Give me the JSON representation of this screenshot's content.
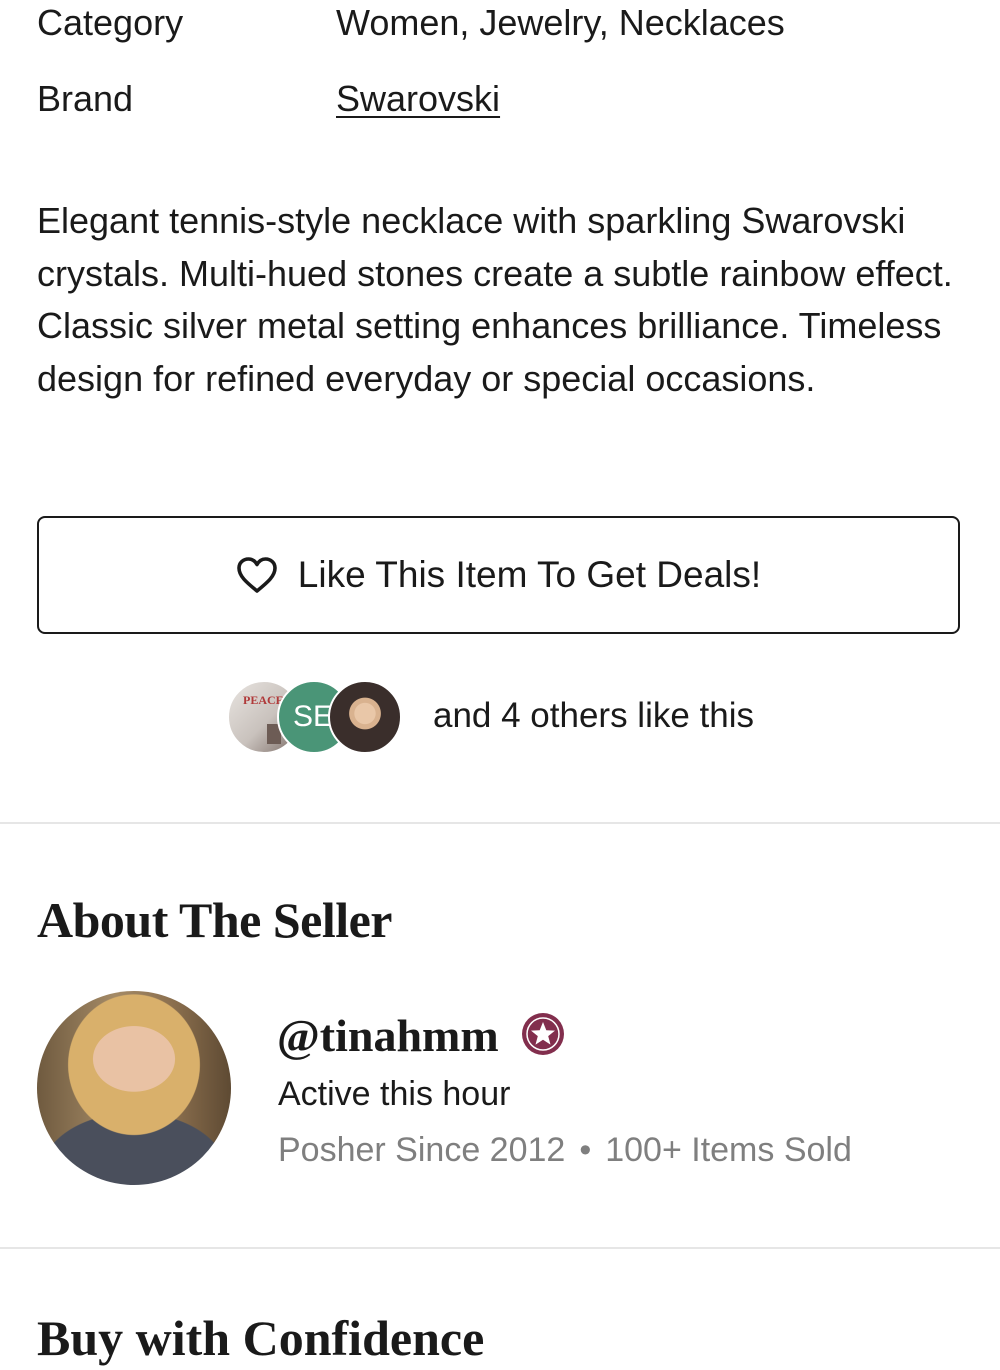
{
  "details": {
    "category_label": "Category",
    "category_value": "Women, Jewelry, Necklaces",
    "brand_label": "Brand",
    "brand_value": "Swarovski"
  },
  "description": "Elegant tennis-style necklace with sparkling Swarovski crystals. Multi-hued stones create a subtle rainbow effect. Classic silver metal setting enhances brilliance. Timeless design for refined everyday or special occasions.",
  "like_button": {
    "label": "Like This Item To Get Deals!",
    "icon": "heart-outline-icon"
  },
  "likers": {
    "avatar_1_text": "PEACE & LOVE",
    "avatar_2_initials": "SE",
    "summary": "and 4 others like this"
  },
  "about_seller": {
    "title": "About The Seller",
    "handle": "@tinahmm",
    "badge_icon": "ambassador-star-icon",
    "badge_color": "#822e4d",
    "status": "Active this hour",
    "since": "Posher Since 2012",
    "separator": "•",
    "items_sold": "100+ Items Sold"
  },
  "next_section": {
    "title": "Buy with Confidence"
  }
}
